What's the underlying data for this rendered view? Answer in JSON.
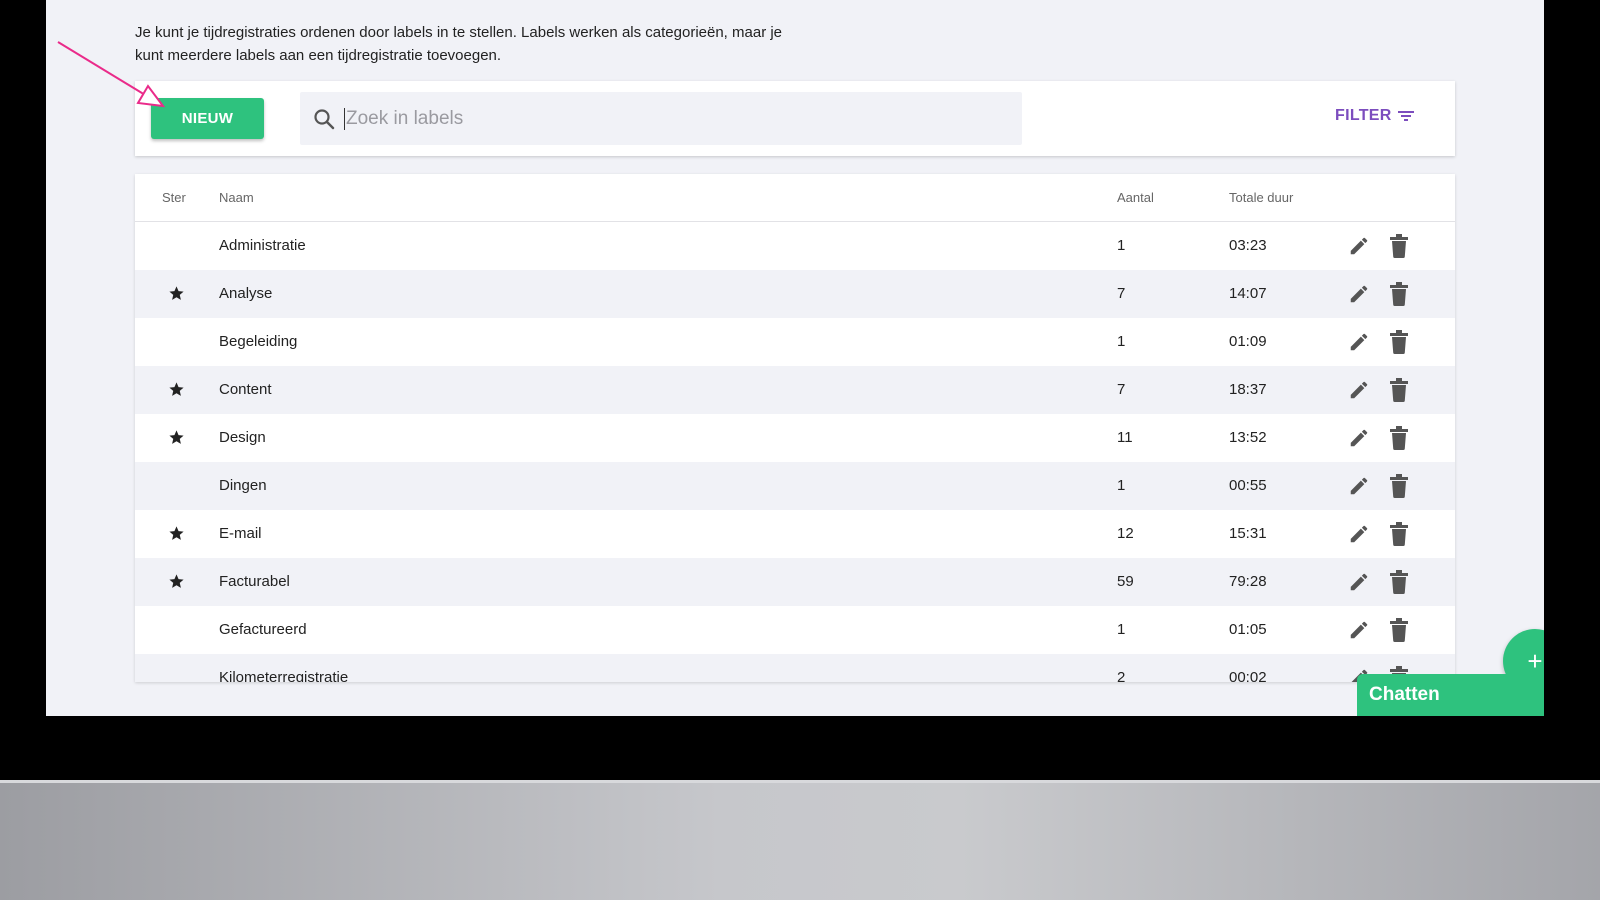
{
  "intro": {
    "line1": "Je kunt je tijdregistraties ordenen door labels in te stellen. Labels werken als categorieën, maar je",
    "line2": "kunt meerdere labels aan een tijdregistratie toevoegen."
  },
  "toolbar": {
    "new_label": "NIEUW",
    "search_placeholder": "Zoek in labels",
    "filter_label": "FILTER",
    "accent_color": "#2ec27e",
    "filter_color": "#7c4dbe"
  },
  "table": {
    "headers": {
      "star": "Ster",
      "name": "Naam",
      "count": "Aantal",
      "duration": "Totale duur"
    },
    "rows": [
      {
        "starred": false,
        "name": "Administratie",
        "count": "1",
        "duration": "03:23"
      },
      {
        "starred": true,
        "name": "Analyse",
        "count": "7",
        "duration": "14:07"
      },
      {
        "starred": false,
        "name": "Begeleiding",
        "count": "1",
        "duration": "01:09"
      },
      {
        "starred": true,
        "name": "Content",
        "count": "7",
        "duration": "18:37"
      },
      {
        "starred": true,
        "name": "Design",
        "count": "11",
        "duration": "13:52"
      },
      {
        "starred": false,
        "name": "Dingen",
        "count": "1",
        "duration": "00:55"
      },
      {
        "starred": true,
        "name": "E-mail",
        "count": "12",
        "duration": "15:31"
      },
      {
        "starred": true,
        "name": "Facturabel",
        "count": "59",
        "duration": "79:28"
      },
      {
        "starred": false,
        "name": "Gefactureerd",
        "count": "1",
        "duration": "01:05"
      },
      {
        "starred": false,
        "name": "Kilometerregistratie",
        "count": "2",
        "duration": "00:02"
      }
    ]
  },
  "fab": {
    "label": "+"
  },
  "chat": {
    "label": "Chatten"
  }
}
